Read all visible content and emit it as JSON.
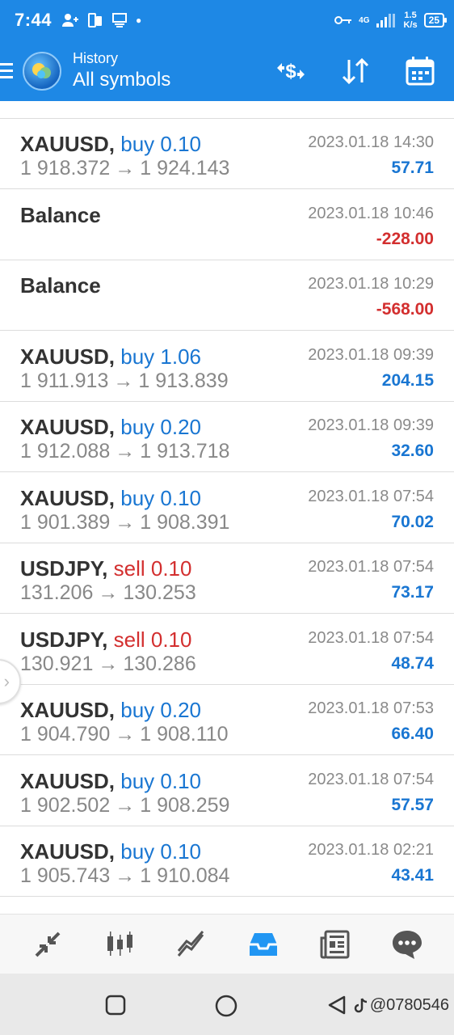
{
  "status_bar": {
    "time": "7:44",
    "network_type": "4G",
    "net_speed_value": "1.5",
    "net_speed_unit": "K/s",
    "battery": "25"
  },
  "app_bar": {
    "subtitle": "History",
    "title": "All symbols",
    "icons": [
      "money-exchange-icon",
      "sort-icon",
      "calendar-icon"
    ]
  },
  "deals": [
    {
      "symbol": "XAUUSD,",
      "action": "buy 0.10",
      "side": "buy",
      "open": "1 918.372",
      "close": "1 924.143",
      "date": "2023.01.18 14:30",
      "profit": "57.71",
      "profit_sign": "pos"
    },
    {
      "symbol": "Balance",
      "action": "",
      "side": "",
      "open": "",
      "close": "",
      "date": "2023.01.18 10:46",
      "profit": "-228.00",
      "profit_sign": "neg"
    },
    {
      "symbol": "Balance",
      "action": "",
      "side": "",
      "open": "",
      "close": "",
      "date": "2023.01.18 10:29",
      "profit": "-568.00",
      "profit_sign": "neg"
    },
    {
      "symbol": "XAUUSD,",
      "action": "buy 1.06",
      "side": "buy",
      "open": "1 911.913",
      "close": "1 913.839",
      "date": "2023.01.18 09:39",
      "profit": "204.15",
      "profit_sign": "pos"
    },
    {
      "symbol": "XAUUSD,",
      "action": "buy 0.20",
      "side": "buy",
      "open": "1 912.088",
      "close": "1 913.718",
      "date": "2023.01.18 09:39",
      "profit": "32.60",
      "profit_sign": "pos"
    },
    {
      "symbol": "XAUUSD,",
      "action": "buy 0.10",
      "side": "buy",
      "open": "1 901.389",
      "close": "1 908.391",
      "date": "2023.01.18 07:54",
      "profit": "70.02",
      "profit_sign": "pos"
    },
    {
      "symbol": "USDJPY,",
      "action": "sell 0.10",
      "side": "sell",
      "open": "131.206",
      "close": "130.253",
      "date": "2023.01.18 07:54",
      "profit": "73.17",
      "profit_sign": "pos"
    },
    {
      "symbol": "USDJPY,",
      "action": "sell 0.10",
      "side": "sell",
      "open": "130.921",
      "close": "130.286",
      "date": "2023.01.18 07:54",
      "profit": "48.74",
      "profit_sign": "pos"
    },
    {
      "symbol": "XAUUSD,",
      "action": "buy 0.20",
      "side": "buy",
      "open": "1 904.790",
      "close": "1 908.110",
      "date": "2023.01.18 07:53",
      "profit": "66.40",
      "profit_sign": "pos"
    },
    {
      "symbol": "XAUUSD,",
      "action": "buy 0.10",
      "side": "buy",
      "open": "1 902.502",
      "close": "1 908.259",
      "date": "2023.01.18 07:54",
      "profit": "57.57",
      "profit_sign": "pos"
    },
    {
      "symbol": "XAUUSD,",
      "action": "buy 0.10",
      "side": "buy",
      "open": "1 905.743",
      "close": "1 910.084",
      "date": "2023.01.18 02:21",
      "profit": "43.41",
      "profit_sign": "pos"
    }
  ],
  "price_arrow": "→",
  "bottom_nav": {
    "items": [
      "quotes-icon",
      "chart-icon",
      "trade-icon",
      "history-icon",
      "news-icon",
      "messages-icon"
    ],
    "active": "history-icon",
    "active_color": "#2196f3",
    "inactive_color": "#555555"
  },
  "system_nav": {
    "watermark": "@0780546"
  },
  "colors": {
    "primary": "#1e88e5",
    "buy": "#1976d2",
    "sell": "#d32f2f",
    "profit_positive": "#1976d2",
    "profit_negative": "#d32f2f"
  }
}
